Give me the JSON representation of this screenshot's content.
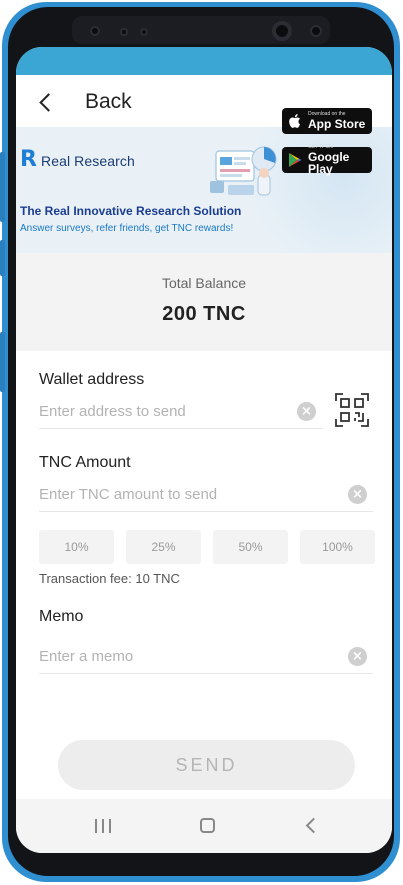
{
  "header": {
    "back_label": "Back"
  },
  "banner": {
    "brand": "Real Research",
    "headline": "The Real Innovative Research Solution",
    "subline": "Answer surveys, refer friends, get TNC rewards!",
    "app_store": {
      "small": "Download on the",
      "big": "App Store"
    },
    "google_play": {
      "small": "GET IT ON",
      "big": "Google Play"
    }
  },
  "balance": {
    "label": "Total Balance",
    "value": "200 TNC"
  },
  "form": {
    "wallet": {
      "label": "Wallet address",
      "placeholder": "Enter address to send",
      "value": ""
    },
    "amount": {
      "label": "TNC Amount",
      "placeholder": "Enter TNC amount to send",
      "value": "",
      "presets": [
        "10%",
        "25%",
        "50%",
        "100%"
      ],
      "fee": "Transaction fee: 10 TNC"
    },
    "memo": {
      "label": "Memo",
      "placeholder": "Enter a memo",
      "value": ""
    },
    "clear_glyph": "×",
    "send_label": "SEND"
  },
  "icons": {
    "back": "chevron-left-icon",
    "clear": "clear-circle-icon",
    "qr": "qr-scan-icon",
    "nav": [
      "recent-apps-icon",
      "home-icon",
      "back-icon"
    ]
  },
  "colors": {
    "status_bar": "#3ba6d3",
    "phone_frame": "#2f8fd0",
    "brand_blue": "#1b3d8f",
    "accent_blue": "#1a78c7"
  }
}
